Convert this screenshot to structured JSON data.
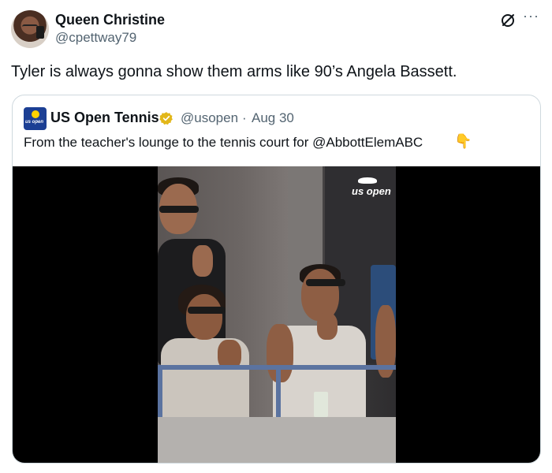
{
  "tweet": {
    "author_name": "Queen Christine",
    "author_handle": "@cpettway79",
    "text": "Tyler is always gonna show them arms like 90’s Angela Bassett.",
    "more_label": "···"
  },
  "quoted": {
    "avatar_text": "us open",
    "author_name": "US Open Tennis",
    "author_handle": "@usopen",
    "separator": "·",
    "date": "Aug 30",
    "text": "From the teacher's lounge to the tennis court for @AbbottElemABC",
    "emoji": "👇",
    "video_watermark": "us open"
  },
  "colors": {
    "text": "#0f1419",
    "secondary": "#536471",
    "border": "#cfd9de",
    "verified_gold": "#e2b719",
    "usopen_blue": "#1c3f94"
  },
  "icons": [
    "grok-icon",
    "more-icon",
    "verified-badge-icon",
    "pointing-down-emoji"
  ]
}
